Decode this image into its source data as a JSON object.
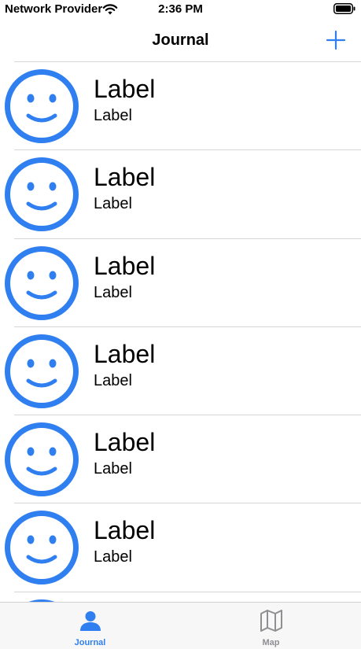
{
  "status_bar": {
    "carrier": "Network Provider",
    "time": "2:36 PM",
    "icons": [
      "wifi-icon",
      "battery-icon"
    ]
  },
  "nav": {
    "title": "Journal",
    "add_icon": "plus-icon"
  },
  "entries": [
    {
      "title": "Label",
      "subtitle": "Label",
      "icon": "smiley-icon"
    },
    {
      "title": "Label",
      "subtitle": "Label",
      "icon": "smiley-icon"
    },
    {
      "title": "Label",
      "subtitle": "Label",
      "icon": "smiley-icon"
    },
    {
      "title": "Label",
      "subtitle": "Label",
      "icon": "smiley-icon"
    },
    {
      "title": "Label",
      "subtitle": "Label",
      "icon": "smiley-icon"
    },
    {
      "title": "Label",
      "subtitle": "Label",
      "icon": "smiley-icon"
    },
    {
      "title": "",
      "subtitle": "",
      "icon": "smiley-icon"
    }
  ],
  "tab_bar": {
    "tabs": [
      {
        "label": "Journal",
        "icon": "person-icon",
        "selected": true
      },
      {
        "label": "Map",
        "icon": "map-icon",
        "selected": false
      }
    ]
  },
  "colors": {
    "accent": "#2f7ff1",
    "inactive": "#8e8e93",
    "separator": "#d6d6da"
  }
}
